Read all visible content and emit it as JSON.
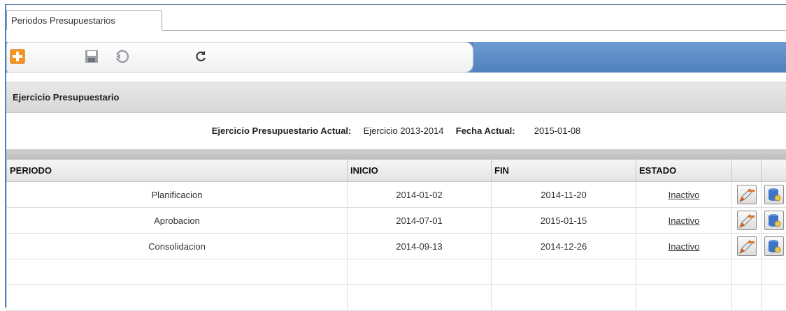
{
  "tab": {
    "label": "Periodos Presupuestarios"
  },
  "toolbar": {
    "buttons": [
      "add-icon",
      "save-icon",
      "undo-icon",
      "refresh-icon"
    ]
  },
  "section": {
    "title": "Ejercicio Presupuestario"
  },
  "info": {
    "ejercicio_label": "Ejercicio Presupuestario Actual:",
    "ejercicio_value": "Ejercicio 2013-2014",
    "fecha_label": "Fecha Actual:",
    "fecha_value": "2015-01-08"
  },
  "table": {
    "headers": [
      "PERIODO",
      "INICIO",
      "FIN",
      "ESTADO",
      "",
      ""
    ],
    "rows": [
      {
        "periodo": "Planificacion",
        "inicio": "2014-01-02",
        "fin": "2014-11-20",
        "estado": "Inactivo"
      },
      {
        "periodo": "Aprobacion",
        "inicio": "2014-07-01",
        "fin": "2015-01-15",
        "estado": "Inactivo"
      },
      {
        "periodo": "Consolidacion",
        "inicio": "2014-09-13",
        "fin": "2014-12-26",
        "estado": "Inactivo"
      }
    ]
  },
  "colors": {
    "accent": "#5b88c5",
    "add": "#f7941d"
  }
}
